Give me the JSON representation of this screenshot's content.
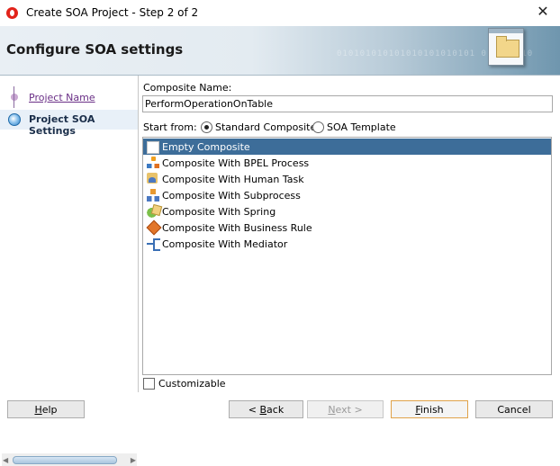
{
  "window": {
    "title": "Create SOA Project - Step 2 of 2"
  },
  "banner": {
    "heading": "Configure SOA settings",
    "binary_text": "010101010101010101010101 010101010"
  },
  "steps": [
    {
      "label": "Project Name"
    },
    {
      "label": "Project SOA Settings"
    }
  ],
  "form": {
    "composite_name_label": "Composite Name:",
    "composite_name_value": "PerformOperationOnTable",
    "start_from_label": "Start from:",
    "options": [
      {
        "label": "Standard Composite",
        "checked": true
      },
      {
        "label": "SOA Template",
        "checked": false
      }
    ]
  },
  "list": {
    "items": [
      {
        "label": "Empty Composite",
        "icon": "empty-composite-icon",
        "selected": true
      },
      {
        "label": "Composite With BPEL Process",
        "icon": "bpel-process-icon"
      },
      {
        "label": "Composite With Human Task",
        "icon": "human-task-icon"
      },
      {
        "label": "Composite With Subprocess",
        "icon": "subprocess-icon"
      },
      {
        "label": "Composite With Spring",
        "icon": "spring-icon"
      },
      {
        "label": "Composite With Business Rule",
        "icon": "business-rule-icon"
      },
      {
        "label": "Composite With Mediator",
        "icon": "mediator-icon"
      }
    ],
    "selected_color": "#3d6d99"
  },
  "customizable": {
    "label": "Customizable",
    "checked": false
  },
  "buttons": {
    "help": {
      "pre": "",
      "u": "H",
      "post": "elp"
    },
    "back": {
      "pre": "< ",
      "u": "B",
      "post": "ack"
    },
    "next": {
      "pre": "",
      "u": "N",
      "post": "ext >"
    },
    "finish": {
      "pre": "",
      "u": "F",
      "post": "inish"
    },
    "cancel": {
      "label": "Cancel"
    }
  }
}
